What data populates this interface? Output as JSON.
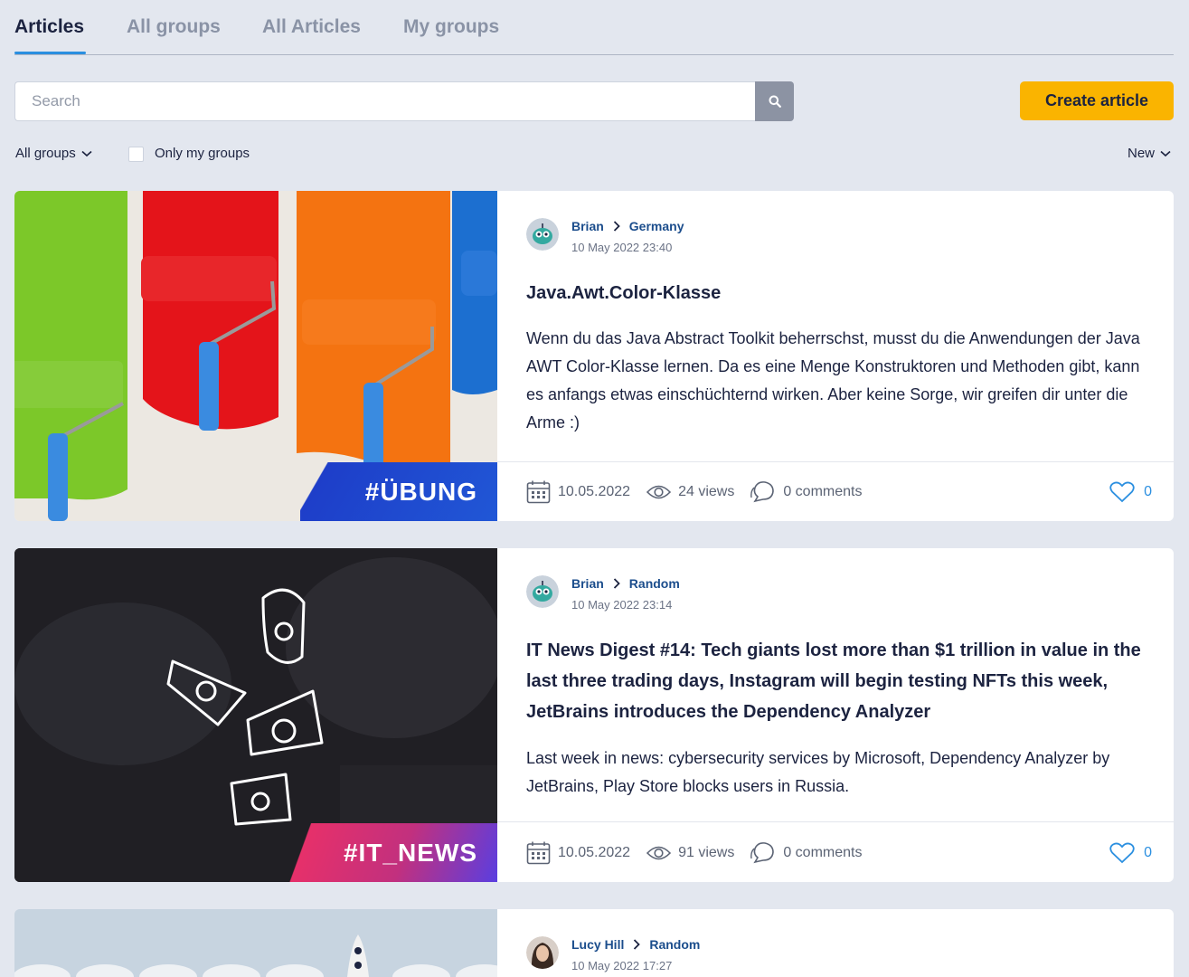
{
  "tabs": [
    {
      "label": "Articles",
      "active": true
    },
    {
      "label": "All groups"
    },
    {
      "label": "All Articles"
    },
    {
      "label": "My groups"
    }
  ],
  "search": {
    "placeholder": "Search"
  },
  "create_button": "Create article",
  "filters": {
    "groups_dropdown": "All groups",
    "only_my_groups_label": "Only my groups",
    "only_my_groups_checked": false,
    "sort": "New"
  },
  "articles": [
    {
      "author": "Brian",
      "group": "Germany",
      "datetime": "10 May 2022 23:40",
      "title": "Java.Awt.Color-Klasse",
      "excerpt": "Wenn du das Java Abstract Toolkit beherrschst, musst du die Anwendungen der Java AWT Color-Klasse lernen. Da es eine Menge Konstruktoren und Methoden gibt, kann es anfangs etwas einschüchternd wirken. Aber keine Sorge, wir greifen dir unter die Arme :)",
      "tag": "#ÜBUNG",
      "date": "10.05.2022",
      "views": "24 views",
      "comments": "0 comments",
      "likes": "0"
    },
    {
      "author": "Brian",
      "group": "Random",
      "datetime": "10 May 2022 23:14",
      "title": "IT News Digest #14: Tech giants lost more than $1 trillion in value in the last three trading days, Instagram will begin testing NFTs this week, JetBrains introduces the Dependency Analyzer",
      "excerpt": "Last week in news: cybersecurity services by Microsoft, Dependency Analyzer by JetBrains, Play Store blocks users in Russia.",
      "tag": "#IT_NEWS",
      "date": "10.05.2022",
      "views": "91 views",
      "comments": "0 comments",
      "likes": "0"
    },
    {
      "author": "Lucy Hill",
      "group": "Random",
      "datetime": "10 May 2022 17:27"
    }
  ],
  "colors": {
    "background": "#e3e7ef",
    "accent_blue": "#2b8fe0",
    "link_blue": "#1b4d8c",
    "create_button": "#fab400"
  }
}
